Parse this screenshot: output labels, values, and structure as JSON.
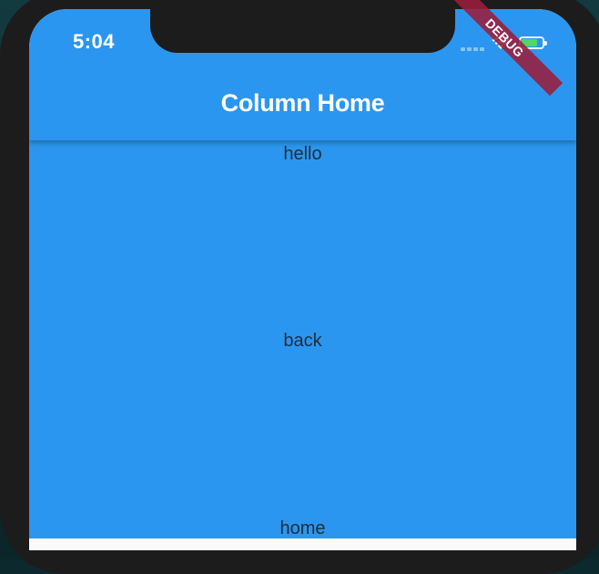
{
  "status_bar": {
    "time": "5:04"
  },
  "app_bar": {
    "title": "Column Home",
    "color": "#2b96ef"
  },
  "column": {
    "items": [
      "hello",
      "back",
      "home"
    ],
    "background": "#2b96ef"
  },
  "debug_banner": {
    "label": "DEBUG"
  }
}
